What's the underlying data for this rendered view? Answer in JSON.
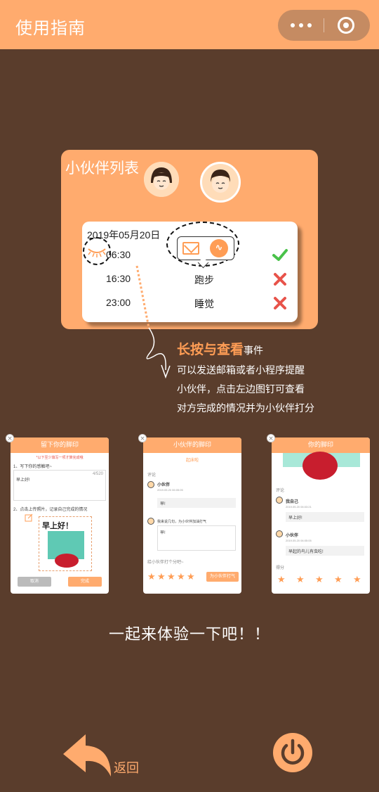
{
  "header": {
    "title": "使用指南"
  },
  "capsule": {
    "more_icon": "more-dots-icon",
    "close_icon": "target-close-icon"
  },
  "demo": {
    "title": "小伙伴列表",
    "date": "2019年05月20日",
    "rows": [
      {
        "time": "06:30",
        "task": "",
        "status": "done"
      },
      {
        "time": "16:30",
        "task": "跑步",
        "status": "undone"
      },
      {
        "time": "23:00",
        "task": "睡觉",
        "status": "undone"
      }
    ],
    "colors": {
      "accent": "#ffab6e",
      "check": "#49c24a",
      "cross": "#e8534a"
    }
  },
  "note": {
    "highlight": "长按与查看",
    "suffix": "事件",
    "lines": [
      "可以发送邮箱或者小程序提醒",
      "小伙伴，点击左边图钉可查看",
      "对方完成的情况并为小伙伴打分"
    ]
  },
  "shot1": {
    "title": "留下你的脚印",
    "warn": "*以下至少填写一项才算完成哦",
    "q1": "1、写下你的感触吧~",
    "counter": "4/520",
    "text": "早上好!",
    "q2": "2、点击上传照片，记录自己完成的情况",
    "sticker": "早上好！",
    "cancel": "取消",
    "done": "完成"
  },
  "shot2": {
    "title": "小伙伴的脚印",
    "sub": "起床啦",
    "section": "评论",
    "user": "小伙伴",
    "time": "2019.05.20 06:05:05",
    "comment": "早!",
    "prompt": "我来说几句，为小伙伴加油打气",
    "reply": "早!",
    "rate_prompt": "给小伙伴打个分吧~",
    "rate_btn": "为小伙伴打气"
  },
  "shot3": {
    "title": "你的脚印",
    "section": "评论",
    "user1": "我自己",
    "time1": "2019.05.20 06:03:21",
    "comment1": "早上好!",
    "user2": "小伙伴",
    "time2": "2019.05.20 06:05:05",
    "comment2": "早起的鸟儿有虫吃!",
    "score_label": "得分"
  },
  "cta": "一起来体验一下吧！！",
  "footer": {
    "back_label": "返回"
  }
}
